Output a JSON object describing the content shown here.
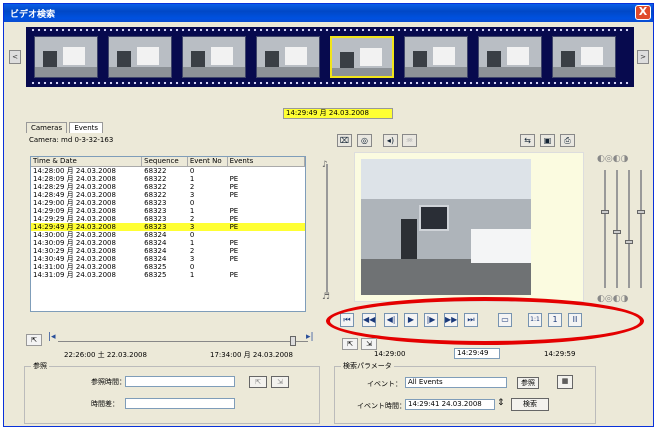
{
  "window": {
    "title": "ビデオ検索",
    "close": "X"
  },
  "filmstrip": {
    "prev": "<",
    "next": ">",
    "selected_timestamp": "14:29:49 月 24.03.2008"
  },
  "tabs": [
    {
      "label": "Cameras"
    },
    {
      "label": "Events"
    }
  ],
  "camera_line": "Camera: md 0-3-32-163",
  "table": {
    "headers": [
      "Time & Date",
      "Sequence",
      "Event No",
      "Events"
    ],
    "rows": [
      [
        "14:28:00 月 24.03.2008",
        "68322",
        "0",
        ""
      ],
      [
        "14:28:09 月 24.03.2008",
        "68322",
        "1",
        "PE"
      ],
      [
        "14:28:29 月 24.03.2008",
        "68322",
        "2",
        "PE"
      ],
      [
        "14:28:49 月 24.03.2008",
        "68322",
        "3",
        "PE"
      ],
      [
        "14:29:00 月 24.03.2008",
        "68323",
        "0",
        ""
      ],
      [
        "14:29:09 月 24.03.2008",
        "68323",
        "1",
        "PE"
      ],
      [
        "14:29:29 月 24.03.2008",
        "68323",
        "2",
        "PE"
      ],
      [
        "14:29:49 月 24.03.2008",
        "68323",
        "3",
        "PE"
      ],
      [
        "14:30:00 月 24.03.2008",
        "68324",
        "0",
        ""
      ],
      [
        "14:30:09 月 24.03.2008",
        "68324",
        "1",
        "PE"
      ],
      [
        "14:30:29 月 24.03.2008",
        "68324",
        "2",
        "PE"
      ],
      [
        "14:30:49 月 24.03.2008",
        "68324",
        "3",
        "PE"
      ],
      [
        "14:31:00 月 24.03.2008",
        "68325",
        "0",
        ""
      ],
      [
        "14:31:09 月 24.03.2008",
        "68325",
        "1",
        "PE"
      ]
    ],
    "selected_index": 7
  },
  "timeline": {
    "start": "22:26:00 土 22.03.2008",
    "end": "17:34:00 月 24.03.2008"
  },
  "reference": {
    "title": "参照",
    "ref_time_label": "参照時間：",
    "duration_label": "時間差："
  },
  "playback": {
    "buttons": [
      "⏮",
      "◀◀",
      "◀|",
      "▶",
      "|▶",
      "▶▶",
      "⏭"
    ],
    "speed": [
      "1:1",
      "1",
      "II"
    ],
    "start_time": "14:29:00",
    "current_time": "14:29:49",
    "end_time": "14:29:59"
  },
  "search_params": {
    "title": "検索パラメータ",
    "event_label": "イベント：",
    "event_value": "All Events",
    "ref_button": "参照",
    "event_time_label": "イベント時間：",
    "event_time_value": "14:29:41 24.03.2008",
    "search_button": "検索"
  },
  "colors": {
    "title_bar": "#0148c6",
    "highlight": "#ffff33",
    "film": "#070a4e",
    "annotation": "#e40000"
  }
}
